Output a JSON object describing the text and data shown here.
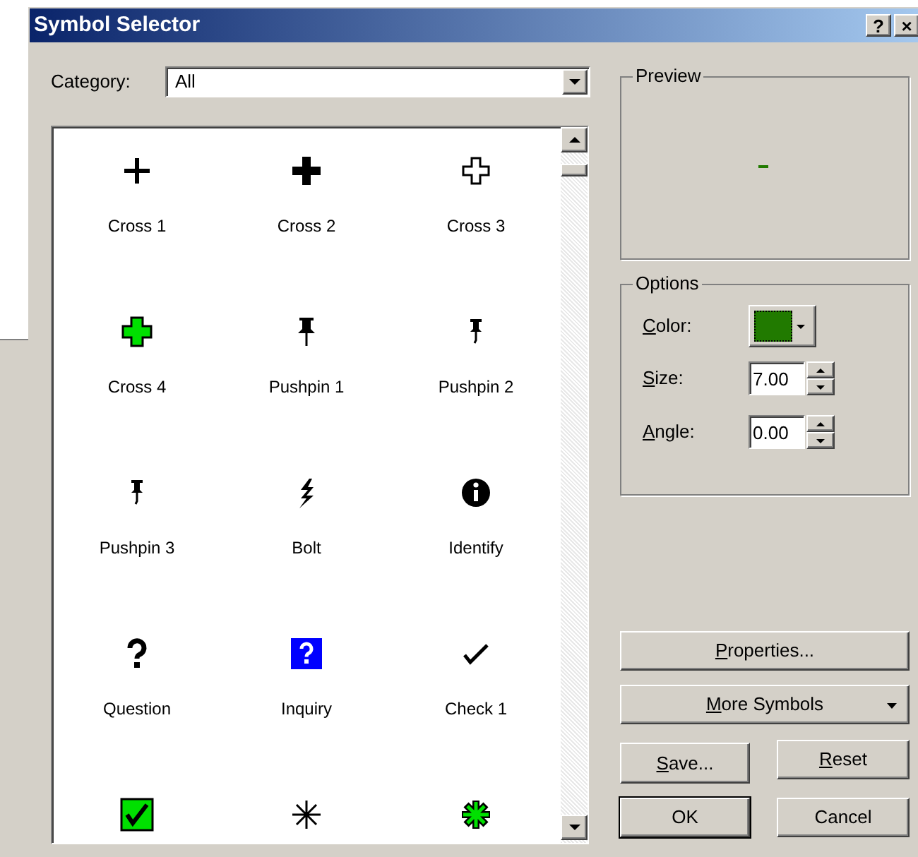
{
  "window": {
    "title": "Symbol Selector",
    "buttons": [
      "?",
      "×"
    ]
  },
  "category": {
    "label": "Category:",
    "mnemonic": false,
    "value": "All"
  },
  "symbols": [
    {
      "kind": "cross-thin",
      "label": "Cross 1"
    },
    {
      "kind": "cross-bold",
      "label": "Cross 2"
    },
    {
      "kind": "cross-outline",
      "label": "Cross 3"
    },
    {
      "kind": "cross-green",
      "label": "Cross 4"
    },
    {
      "kind": "pushpin-large",
      "label": "Pushpin 1"
    },
    {
      "kind": "pushpin-small",
      "label": "Pushpin 2"
    },
    {
      "kind": "pushpin-small",
      "label": "Pushpin 3"
    },
    {
      "kind": "bolt",
      "label": "Bolt"
    },
    {
      "kind": "info",
      "label": "Identify"
    },
    {
      "kind": "question",
      "label": "Question"
    },
    {
      "kind": "inquiry",
      "label": "Inquiry"
    },
    {
      "kind": "check",
      "label": "Check 1"
    },
    {
      "kind": "check-box"
    },
    {
      "kind": "asterisk"
    },
    {
      "kind": "star-green"
    }
  ],
  "preview": {
    "title": "Preview"
  },
  "options": {
    "title": "Options",
    "color": {
      "label": "Color:",
      "mnemonic": true,
      "color": "#217a00"
    },
    "size": {
      "label": "Size:",
      "mnemonic": true,
      "value": "7.00"
    },
    "angle": {
      "label": "Angle:",
      "mnemonic": true,
      "value": "0.00"
    }
  },
  "buttons": [
    {
      "kind": "wide",
      "label": "Properties...",
      "mnemonic": true
    },
    {
      "kind": "dropdown",
      "label": "More Symbols",
      "mnemonic": true
    },
    {
      "kind": "left",
      "label": "Save...",
      "mnemonic": true
    },
    {
      "kind": "right",
      "label": "Reset",
      "mnemonic": true
    },
    {
      "kind": "left-default",
      "label": "OK",
      "mnemonic": false
    },
    {
      "kind": "right",
      "label": "Cancel",
      "mnemonic": false
    }
  ]
}
